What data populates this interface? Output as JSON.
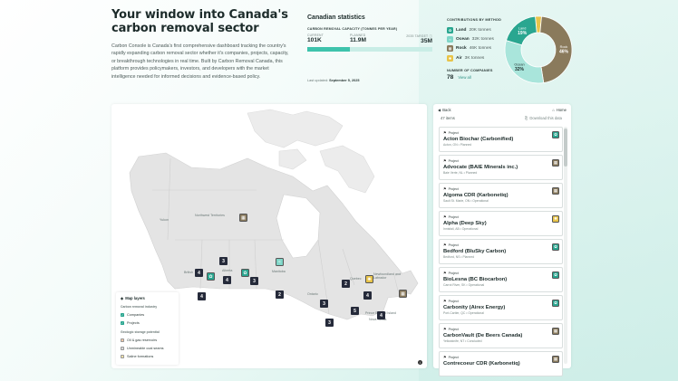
{
  "intro": {
    "title": "Your window into Canada's carbon removal sector",
    "description": "Carbon Console is Canada's first comprehensive dashboard tracking the country's rapidly expanding carbon removal sector whether it's companies, projects, capacity, or breakthrough technologies in real time. Built by Carbon Removal Canada, this platform provides policymakers, investors, and developers with the market intelligence needed for informed decisions and evidence-based policy."
  },
  "stats": {
    "title": "Canadian statistics",
    "capacity_label": "CARBON REMOVAL CAPACITY (TONNES PER YEAR)",
    "current_label": "CURRENT",
    "current_value": "101K",
    "planned_label": "PLANNED",
    "planned_value": "11.9M",
    "target_label": "2035 TARGET ⓘ",
    "target_value": "35M",
    "progress_fraction": 0.34,
    "updated_label": "Last updated:",
    "updated_value": "September 5, 2025"
  },
  "contributions": {
    "title": "CONTRIBUTIONS BY METHOD",
    "methods": [
      {
        "name": "Land",
        "value": "20K tonnes",
        "color": "#2aa690",
        "icon": "leaf-icon",
        "glyph": "✿"
      },
      {
        "name": "Ocean",
        "value": "32K tonnes",
        "color": "#7fd6c8",
        "icon": "wave-icon",
        "glyph": "≈"
      },
      {
        "name": "Rock",
        "value": "46K tonnes",
        "color": "#8a7a5c",
        "icon": "rock-icon",
        "glyph": "▦"
      },
      {
        "name": "Air",
        "value": "3K tonnes",
        "color": "#e8c44a",
        "icon": "air-icon",
        "glyph": "✺"
      }
    ],
    "companies_label": "NUMBER OF COMPANIES",
    "companies_count": "78",
    "view_all": "View all",
    "donut": {
      "slices": [
        {
          "label": "Rock",
          "percent": "46%",
          "value": 46,
          "color": "#8a7a5c"
        },
        {
          "label": "Ocean",
          "percent": "32%",
          "value": 32,
          "color": "#a9e5db"
        },
        {
          "label": "Land",
          "percent": "19%",
          "value": 19,
          "color": "#2aa690"
        },
        {
          "label": "",
          "percent": "",
          "value": 3,
          "color": "#e8c44a"
        }
      ]
    }
  },
  "map": {
    "labels": {
      "yukon": "Yukon",
      "nwt": "Northwest Territories",
      "bc": "British",
      "alberta": "Alberta",
      "manitoba": "Manitoba",
      "ontario": "Ontario",
      "quebec": "Quebec",
      "nl": "Newfoundland and Labrador",
      "ns": "Nova Scotia",
      "pei": "Prince Edward Island"
    },
    "clusters": [
      "3",
      "4",
      "4",
      "3",
      "4",
      "2",
      "2",
      "3",
      "3",
      "4",
      "5",
      "4"
    ],
    "layers": {
      "title": "Map layers",
      "section1": "Carbon removal industry",
      "companies": "Companies",
      "projects": "Projects",
      "section2": "Geologic storage potential",
      "oil_gas": "Oil & gas reservoirs",
      "coal": "Unmineable coal seams",
      "saline": "Saline formations"
    }
  },
  "list": {
    "back": "Back",
    "home": "Home",
    "count": "47 items",
    "download": "Download this data",
    "items": [
      {
        "kind": "Project",
        "name": "Acton Biochar (Carbonified)",
        "meta": "Acton, ON • Planned",
        "method": "land",
        "color": "#2aa690",
        "glyph": "✿"
      },
      {
        "kind": "Project",
        "name": "Advocate (BAIE Minerals inc.)",
        "meta": "Baie Verte, NL • Planned",
        "method": "rock",
        "color": "#8a7a5c",
        "glyph": "▦"
      },
      {
        "kind": "Project",
        "name": "Algoma CDR (Karbonetiq)",
        "meta": "Sault St. Marie, ON • Operational",
        "method": "rock",
        "color": "#8a7a5c",
        "glyph": "▦"
      },
      {
        "kind": "Project",
        "name": "Alpha (Deep Sky)",
        "meta": "Innisfail, AB • Operational",
        "method": "air",
        "color": "#e8c44a",
        "glyph": "✺"
      },
      {
        "kind": "Project",
        "name": "Bedford (BluSky Carbon)",
        "meta": "Bedford, NS • Planned",
        "method": "land",
        "color": "#2aa690",
        "glyph": "✿"
      },
      {
        "kind": "Project",
        "name": "BioLesna (BC Biocarbon)",
        "meta": "Carrot River, SK • Operational",
        "method": "land",
        "color": "#2aa690",
        "glyph": "✿"
      },
      {
        "kind": "Project",
        "name": "Carbonity (Airex Energy)",
        "meta": "Port-Cartier, QC • Operational",
        "method": "land",
        "color": "#2aa690",
        "glyph": "✿"
      },
      {
        "kind": "Project",
        "name": "CarbonVault (De Beers Canada)",
        "meta": "Yellowknife, NT • Concluded",
        "method": "rock",
        "color": "#8a7a5c",
        "glyph": "▦"
      },
      {
        "kind": "Project",
        "name": "Contrecoeur CDR (Karbonetiq)",
        "meta": "",
        "method": "rock",
        "color": "#8a7a5c",
        "glyph": "▦"
      }
    ]
  }
}
